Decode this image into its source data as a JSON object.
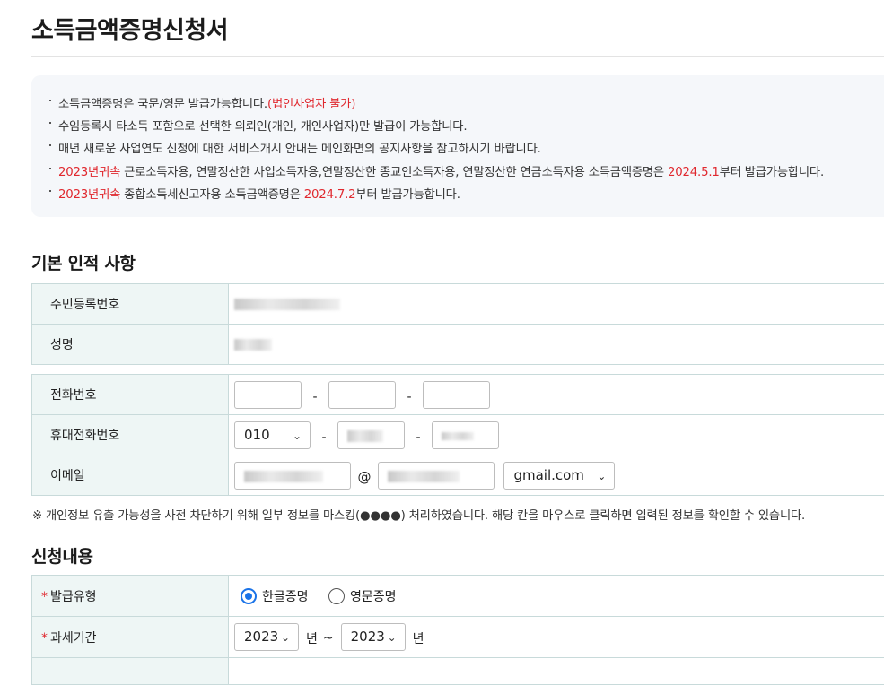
{
  "page_title": "소득금액증명신청서",
  "notice": {
    "line1_text": "소득금액증명은 국문/영문 발급가능합니다.",
    "line1_red": "(법인사업자 불가)",
    "line2": "수임등록시 타소득 포함으로 선택한 의뢰인(개인, 개인사업자)만 발급이 가능합니다.",
    "line3": "매년 새로운 사업연도 신청에 대한 서비스개시 안내는 메인화면의 공지사항을 참고하시기 바랍니다.",
    "line4_red1": "2023년귀속",
    "line4_mid": " 근로소득자용, 연말정산한 사업소득자용,연말정산한 종교인소득자용, 연말정산한 연금소득자용 소득금액증명은 ",
    "line4_red2": "2024.5.1",
    "line4_end": "부터 발급가능합니다.",
    "line5_red1": "2023년귀속",
    "line5_mid": " 종합소득세신고자용 소득금액증명은 ",
    "line5_red2": "2024.7.2",
    "line5_end": "부터 발급가능합니다."
  },
  "basic_info": {
    "title": "기본 인적 사항",
    "rrn_label": "주민등록번호",
    "name_label": "성명"
  },
  "contact": {
    "phone_label": "전화번호",
    "mobile_label": "휴대전화번호",
    "mobile_prefix": "010",
    "email_label": "이메일",
    "email_domain": "gmail.com",
    "dash": "-",
    "at": "@"
  },
  "mask_note": "※ 개인정보 유출 가능성을 사전 차단하기 위해 일부 정보를 마스킹(●●●●) 처리하였습니다. 해당 칸을 마우스로 클릭하면 입력된 정보를 확인할 수 있습니다.",
  "application": {
    "title": "신청내용",
    "required_mark": "*",
    "issue_type_label": "발급유형",
    "option_korean": "한글증명",
    "option_english": "영문증명",
    "selected_option": "한글증명",
    "tax_period_label": "과세기간",
    "year_from": "2023",
    "year_to": "2023",
    "year_unit": "년",
    "tilde": "~"
  },
  "icons": {
    "select_arrow": "chevron-down-icon"
  },
  "colors": {
    "accent_red": "#e0282e",
    "radio_blue": "#1a73e8",
    "label_bg": "#eef6f5",
    "notice_bg": "#f5f7fa"
  }
}
